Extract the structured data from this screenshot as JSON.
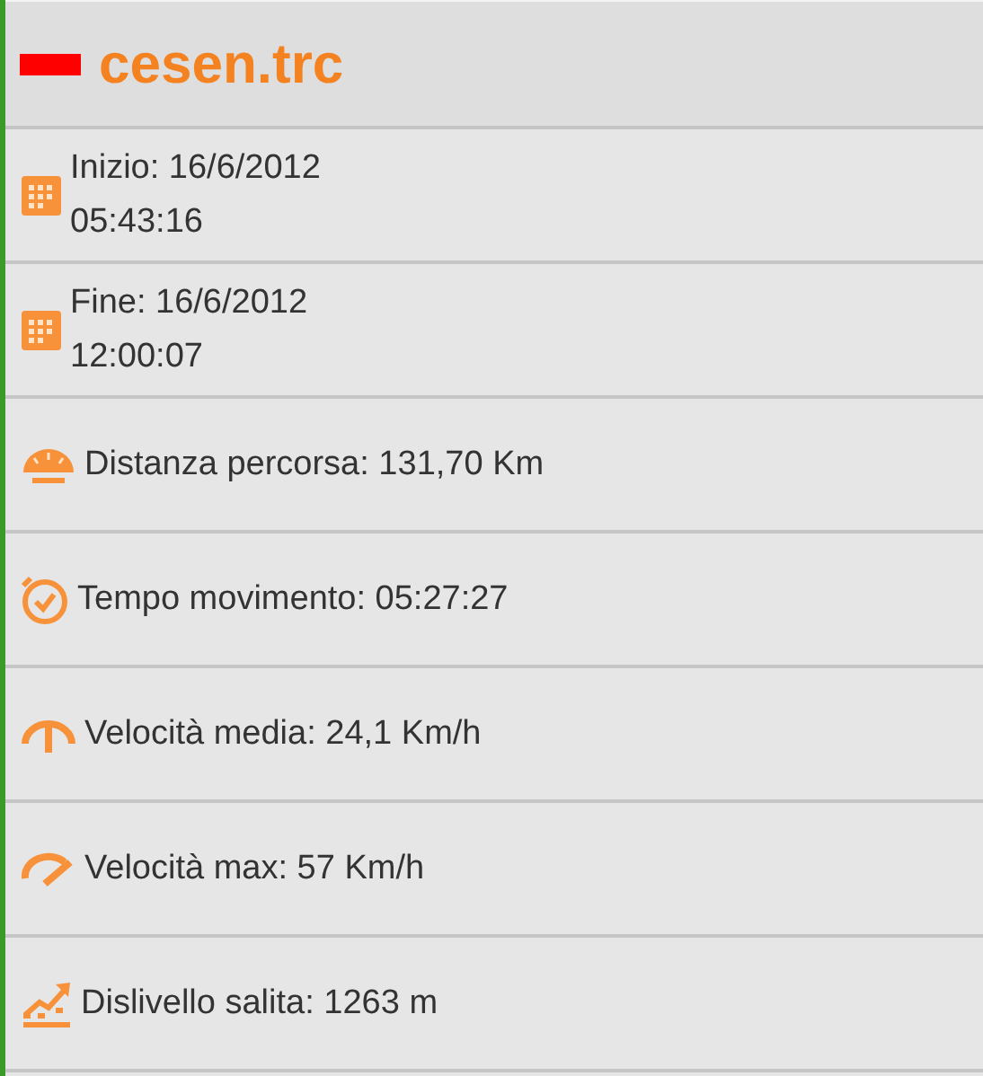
{
  "track": {
    "name": "cesen.trc",
    "color": "#ff0000"
  },
  "stats": [
    {
      "kind": "calendar",
      "lines": [
        "Inizio: 16/6/2012",
        "05:43:16"
      ]
    },
    {
      "kind": "calendar",
      "lines": [
        "Fine: 16/6/2012",
        "12:00:07"
      ]
    },
    {
      "kind": "odometer",
      "lines": [
        "Distanza percorsa: 131,70 Km"
      ]
    },
    {
      "kind": "clock",
      "lines": [
        "Tempo movimento: 05:27:27"
      ]
    },
    {
      "kind": "gauge-mid",
      "lines": [
        "Velocità media: 24,1 Km/h"
      ]
    },
    {
      "kind": "gauge-max",
      "lines": [
        "Velocità max: 57 Km/h"
      ]
    },
    {
      "kind": "climb",
      "lines": [
        "Dislivello salita: 1263 m"
      ]
    }
  ]
}
